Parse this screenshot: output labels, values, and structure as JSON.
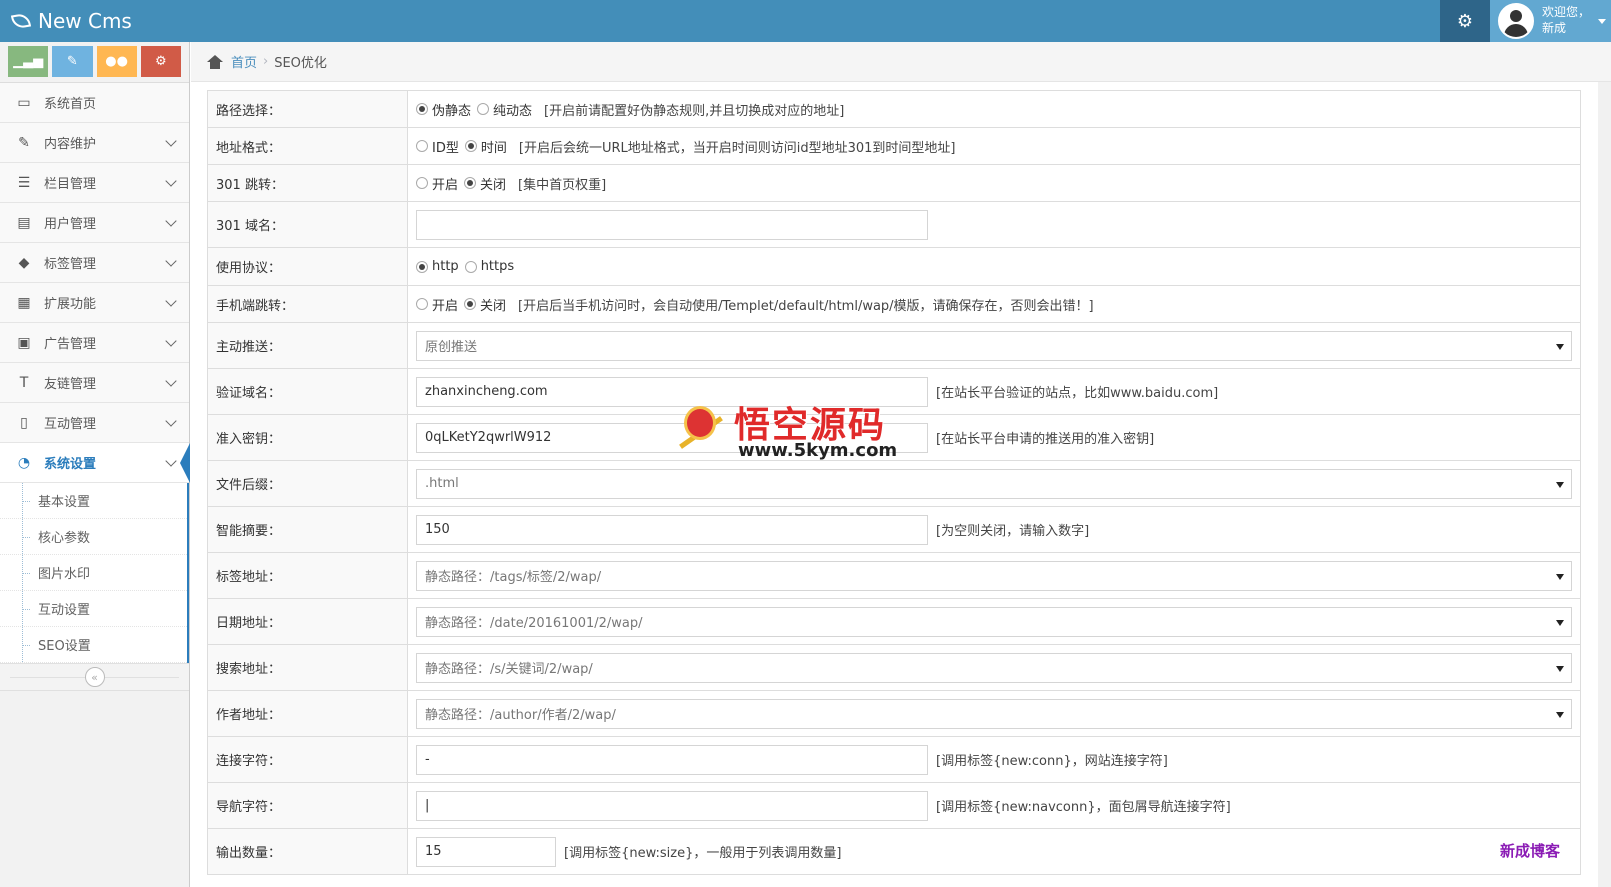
{
  "app": {
    "title": "New Cms"
  },
  "topbar": {
    "welcome_line1": "欢迎您，",
    "welcome_line2": "新成"
  },
  "sidebar": {
    "items": [
      {
        "label": "系统首页",
        "icon": "desktop-icon",
        "glyph": "▭",
        "chevron": false
      },
      {
        "label": "内容维护",
        "icon": "edit-icon",
        "glyph": "✎",
        "chevron": true
      },
      {
        "label": "栏目管理",
        "icon": "list-icon",
        "glyph": "☰",
        "chevron": true
      },
      {
        "label": "用户管理",
        "icon": "id-card-icon",
        "glyph": "▤",
        "chevron": true
      },
      {
        "label": "标签管理",
        "icon": "tag-icon",
        "glyph": "◆",
        "chevron": true
      },
      {
        "label": "扩展功能",
        "icon": "calendar-icon",
        "glyph": "▦",
        "chevron": true
      },
      {
        "label": "广告管理",
        "icon": "picture-icon",
        "glyph": "▣",
        "chevron": true
      },
      {
        "label": "友链管理",
        "icon": "text-icon",
        "glyph": "T",
        "chevron": true
      },
      {
        "label": "互动管理",
        "icon": "file-icon",
        "glyph": "▯",
        "chevron": true
      }
    ],
    "active": {
      "label": "系统设置",
      "icon": "dashboard-icon",
      "glyph": "◔"
    },
    "sub_items": [
      "基本设置",
      "核心参数",
      "图片水印",
      "互动设置",
      "SEO设置"
    ]
  },
  "breadcrumb": {
    "home": "首页",
    "current": "SEO优化"
  },
  "form": {
    "path_mode": {
      "label": "路径选择：",
      "opt1": "伪静态",
      "opt2": "纯动态",
      "hint": "[开启前请配置好伪静态规则,并且切换成对应的地址]"
    },
    "url_format": {
      "label": "地址格式：",
      "opt1": "ID型",
      "opt2": "时间",
      "hint": "[开启后会统一URL地址格式，当开启时间则访问id型地址301到时间型地址]"
    },
    "redirect_301": {
      "label": "301 跳转：",
      "opt1": "开启",
      "opt2": "关闭",
      "hint": "[集中首页权重]"
    },
    "domain_301": {
      "label": "301 域名：",
      "value": ""
    },
    "protocol": {
      "label": "使用协议：",
      "opt1": "http",
      "opt2": "https"
    },
    "mobile_redirect": {
      "label": "手机端跳转：",
      "opt1": "开启",
      "opt2": "关闭",
      "hint": "[开启后当手机访问时，会自动使用/Templet/default/html/wap/模版，请确保存在，否则会出错！]"
    },
    "active_push": {
      "label": "主动推送：",
      "value": "原创推送"
    },
    "verify_domain": {
      "label": "验证域名：",
      "value": "zhanxincheng.com",
      "hint": "[在站长平台验证的站点，比如www.baidu.com]"
    },
    "access_key": {
      "label": "准入密钥：",
      "value": "0qLKetY2qwrlW912",
      "hint": "[在站长平台申请的推送用的准入密钥]"
    },
    "file_suffix": {
      "label": "文件后缀：",
      "value": ".html"
    },
    "smart_summary": {
      "label": "智能摘要：",
      "value": "150",
      "hint": "[为空则关闭，请输入数字]"
    },
    "tag_url": {
      "label": "标签地址：",
      "value": "静态路径：/tags/标签/2/wap/"
    },
    "date_url": {
      "label": "日期地址：",
      "value": "静态路径：/date/20161001/2/wap/"
    },
    "search_url": {
      "label": "搜索地址：",
      "value": "静态路径：/s/关键词/2/wap/"
    },
    "author_url": {
      "label": "作者地址：",
      "value": "静态路径：/author/作者/2/wap/"
    },
    "conn_char": {
      "label": "连接字符：",
      "value": "-",
      "hint": "[调用标签{new:conn}，网站连接字符]"
    },
    "nav_char": {
      "label": "导航字符：",
      "value": "|",
      "hint": "[调用标签{new:navconn}，面包屑导航连接字符]"
    },
    "output_count": {
      "label": "输出数量：",
      "value": "15",
      "hint": "[调用标签{new:size}，一般用于列表调用数量]"
    }
  },
  "watermark": {
    "title": "悟空源码",
    "url": "www.5kym.com"
  },
  "corner_mark": "新成博客"
}
